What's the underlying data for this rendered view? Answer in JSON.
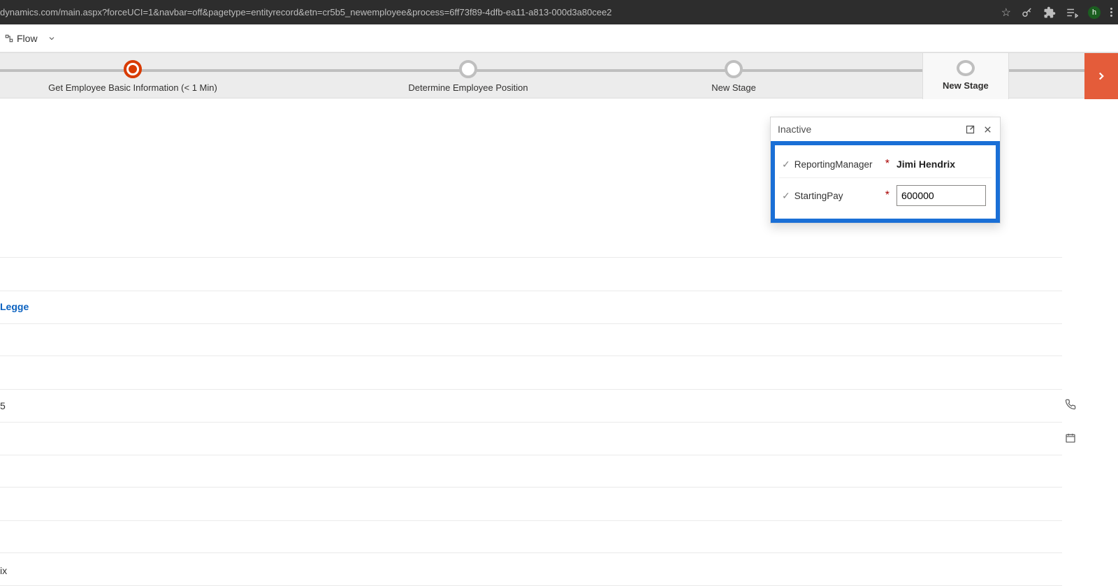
{
  "browser": {
    "url": "dynamics.com/main.aspx?forceUCI=1&navbar=off&pagetype=entityrecord&etn=cr5b5_newemployee&process=6ff73f89-4dfb-ea11-a813-000d3a80cee2",
    "avatar_letter": "h"
  },
  "command_bar": {
    "flow_label": "Flow"
  },
  "process": {
    "stages": [
      {
        "label": "Get Employee Basic Information  (< 1 Min)"
      },
      {
        "label": "Determine Employee Position"
      },
      {
        "label": "New Stage"
      },
      {
        "label": "New Stage"
      }
    ]
  },
  "popup": {
    "status": "Inactive",
    "fields": [
      {
        "label": "ReportingManager",
        "value": "Jimi Hendrix"
      },
      {
        "label": "StartingPay",
        "value": "600000"
      }
    ]
  },
  "body": {
    "link": "Legge",
    "row5_text": "5",
    "row_last_text": "ix"
  }
}
